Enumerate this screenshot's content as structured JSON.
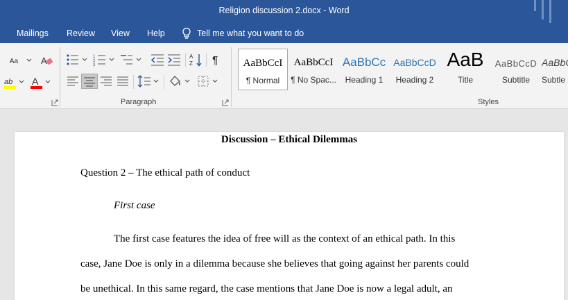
{
  "window": {
    "title": "Religion discussion 2.docx  -  Word"
  },
  "menu": {
    "tabs": [
      "Mailings",
      "Review",
      "View",
      "Help"
    ],
    "tell_me": "Tell me what you want to do"
  },
  "ribbon": {
    "groups": {
      "paragraph": "Paragraph",
      "styles": "Styles"
    },
    "styles": [
      {
        "sample": "AaBbCcI",
        "name": "¶ Normal",
        "selected": true
      },
      {
        "sample": "AaBbCcI",
        "name": "¶ No Spac..."
      },
      {
        "sample": "AaBbCc",
        "name": "Heading 1"
      },
      {
        "sample": "AaBbCcD",
        "name": "Heading 2"
      },
      {
        "sample": "AaB",
        "name": "Title"
      },
      {
        "sample": "AaBbCcD",
        "name": "Subtitle"
      },
      {
        "sample": "AaBbCcD",
        "name": "Subtle E"
      }
    ],
    "colors": {
      "highlight": "#ffff00",
      "font_color": "#ff0000"
    }
  },
  "document": {
    "heading": "Discussion – Ethical Dilemmas",
    "question": "Question 2 – The ethical path of conduct",
    "subheading": "First case",
    "paragraph_lines": [
      "The first case features the idea of free will as the context of an ethical path. In this",
      "case, Jane Doe is only in a dilemma because she believes that going against her parents could",
      "be unethical. In this same regard, the case mentions that Jane Doe is now a legal adult, an"
    ]
  },
  "theme": {
    "title_bar": "#2b579a",
    "ribbon_bg": "#f3f3f3",
    "canvas_bg": "#e6e6e6"
  }
}
